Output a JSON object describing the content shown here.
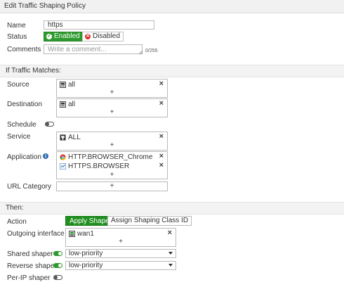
{
  "window": {
    "title": "Edit Traffic Shaping Policy"
  },
  "form": {
    "name": {
      "label": "Name",
      "value": "https"
    },
    "status": {
      "label": "Status",
      "enabled_label": "Enabled",
      "disabled_label": "Disabled",
      "selected": "Enabled"
    },
    "comments": {
      "label": "Comments",
      "placeholder": "Write a comment...",
      "counter": "0/255"
    }
  },
  "if_section": {
    "heading": "If Traffic Matches:",
    "source": {
      "label": "Source",
      "items": [
        "all"
      ],
      "add": "+"
    },
    "destination": {
      "label": "Destination",
      "items": [
        "all"
      ],
      "add": "+"
    },
    "schedule": {
      "label": "Schedule",
      "enabled": false
    },
    "service": {
      "label": "Service",
      "items": [
        "ALL"
      ],
      "add": "+"
    },
    "application": {
      "label": "Application",
      "items": [
        "HTTP.BROWSER_Chrome",
        "HTTPS.BROWSER"
      ],
      "add": "+"
    },
    "url_category": {
      "label": "URL Category",
      "add": "+"
    }
  },
  "then_section": {
    "heading": "Then:",
    "action": {
      "label": "Action",
      "options": [
        "Apply Shaper",
        "Assign Shaping Class ID"
      ],
      "selected": "Apply Shaper"
    },
    "outgoing_interface": {
      "label": "Outgoing interface",
      "items": [
        "wan1"
      ],
      "add": "+"
    },
    "shared_shaper": {
      "label": "Shared shaper",
      "enabled": true,
      "value": "low-priority"
    },
    "reverse_shaper": {
      "label": "Reverse shaper",
      "enabled": true,
      "value": "low-priority"
    },
    "per_ip_shaper": {
      "label": "Per-IP shaper",
      "enabled": false
    }
  },
  "icons": {
    "remove": "×",
    "ok": "✓",
    "x": "✕"
  },
  "colors": {
    "accent_green": "#2d9a2d",
    "danger_red": "#d9302c",
    "info_blue": "#2f6fad"
  }
}
